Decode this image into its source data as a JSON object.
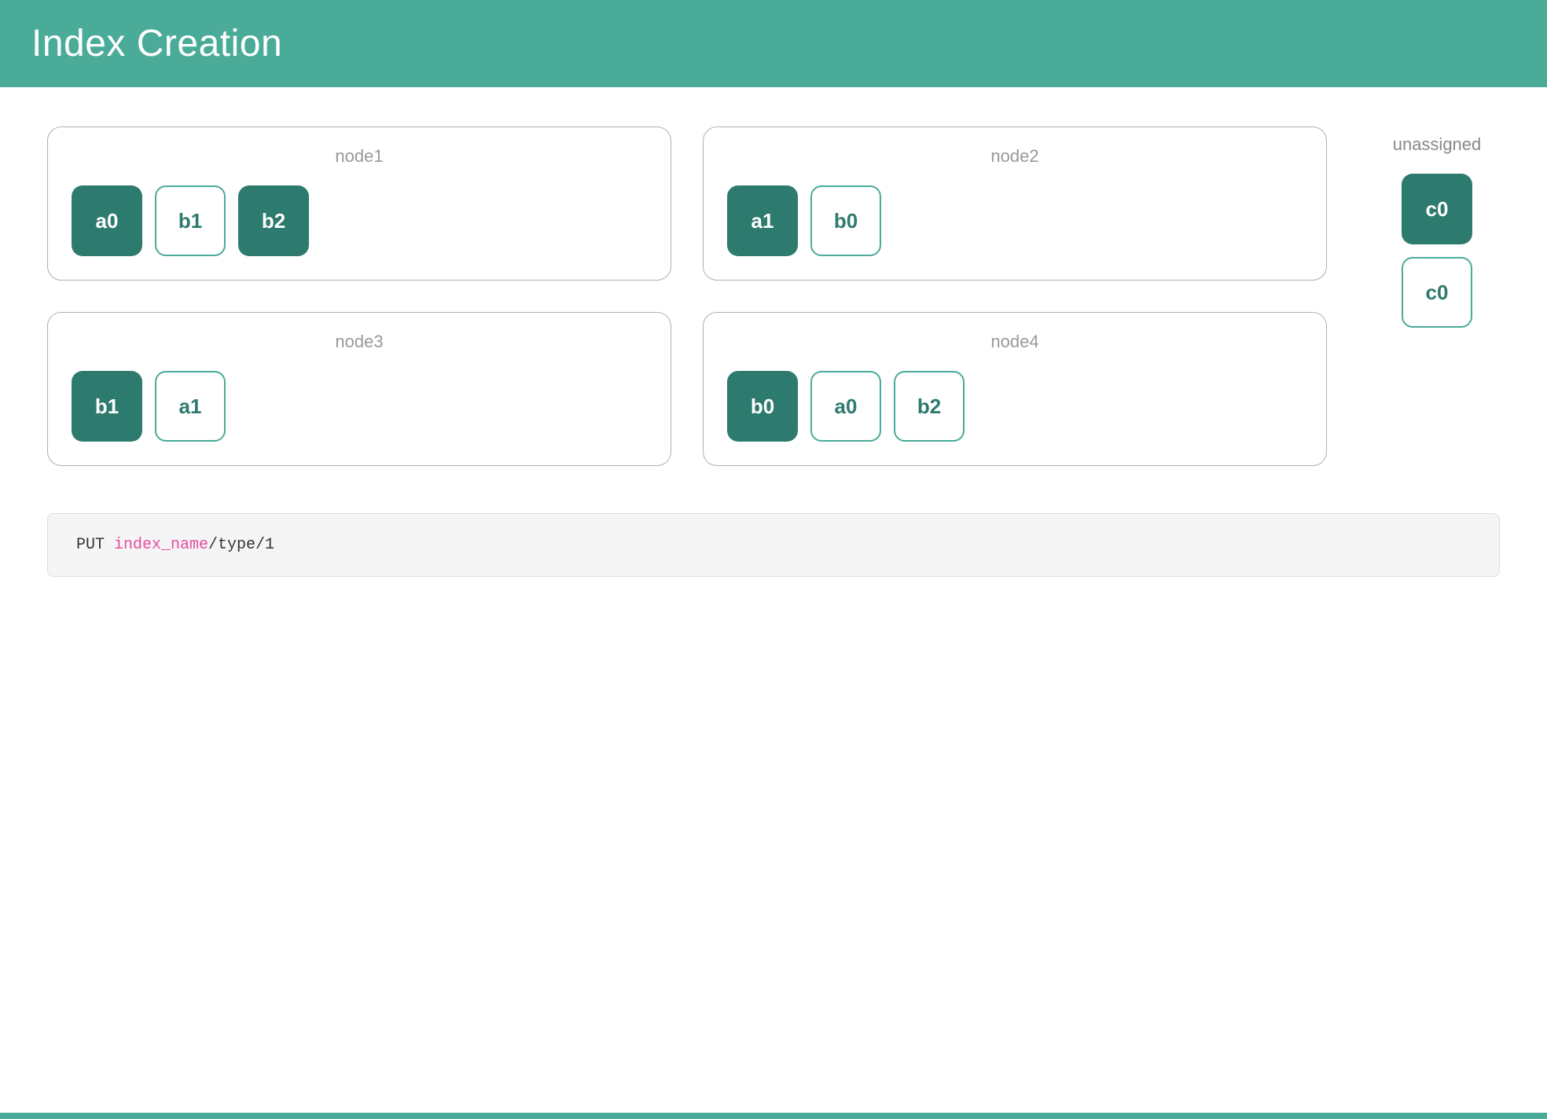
{
  "header": {
    "title": "Index Creation"
  },
  "nodes": [
    {
      "id": "node1",
      "label": "node1",
      "shards": [
        {
          "label": "a0",
          "type": "primary"
        },
        {
          "label": "b1",
          "type": "replica"
        },
        {
          "label": "b2",
          "type": "primary"
        }
      ]
    },
    {
      "id": "node2",
      "label": "node2",
      "shards": [
        {
          "label": "a1",
          "type": "primary"
        },
        {
          "label": "b0",
          "type": "replica"
        }
      ]
    },
    {
      "id": "node3",
      "label": "node3",
      "shards": [
        {
          "label": "b1",
          "type": "primary"
        },
        {
          "label": "a1",
          "type": "replica"
        }
      ]
    },
    {
      "id": "node4",
      "label": "node4",
      "shards": [
        {
          "label": "b0",
          "type": "primary"
        },
        {
          "label": "a0",
          "type": "replica"
        },
        {
          "label": "b2",
          "type": "replica"
        }
      ]
    }
  ],
  "unassigned": {
    "title": "unassigned",
    "shards": [
      {
        "label": "c0",
        "type": "primary"
      },
      {
        "label": "c0",
        "type": "replica"
      }
    ]
  },
  "code": {
    "prefix": "PUT ",
    "highlight": "index_name",
    "suffix": "/type/1"
  }
}
